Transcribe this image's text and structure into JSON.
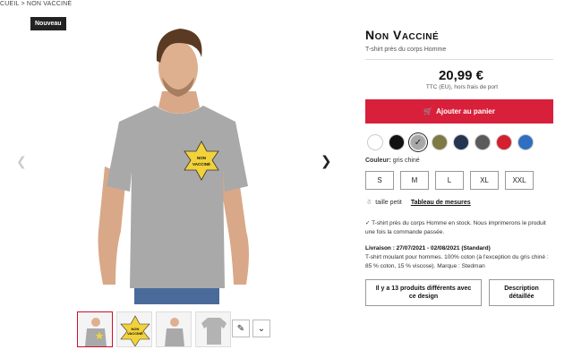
{
  "breadcrumb": "CUEIL > NON VACCINÉ",
  "badge": "Nouveau",
  "product": {
    "title": "Non Vacciné",
    "subtitle": "T-shirt près du corps Homme",
    "price": "20,99 €",
    "price_note": "TTC (EU), hors frais de port",
    "star_text_line1": "NON",
    "star_text_line2": "VACCINÉ"
  },
  "cart": {
    "label": "Ajouter au panier"
  },
  "colors": {
    "swatches": [
      "#ffffff",
      "#111111",
      "#a8a8a8",
      "#7d7a45",
      "#243552",
      "#5b5b5b",
      "#d3202f",
      "#2f6fc0"
    ],
    "label_prefix": "Couleur:",
    "selected": "gris chiné"
  },
  "sizes": [
    "S",
    "M",
    "L",
    "XL",
    "XXL"
  ],
  "size_info": {
    "fit": "taille petit",
    "chart_link": "Tableau de mesures"
  },
  "stock_text": "T-shirt près du corps Homme en stock. Nous imprimerons le produit une fois la commande passée.",
  "delivery": {
    "label": "Livraison : 27/07/2021 - 02/08/2021 (Standard)",
    "description": "T-shirt moulant pour hommes. 100% coton (à l'exception du gris chiné : 85 % coton, 15 % viscose). Marque : Stedman"
  },
  "buttons": {
    "variants": "Il y a 13 produits différents avec ce design",
    "details": "Description détaillée"
  },
  "colors_theme": {
    "accent": "#d8203a",
    "shirt": "#a9a9a9",
    "star": "#f2d23b"
  }
}
